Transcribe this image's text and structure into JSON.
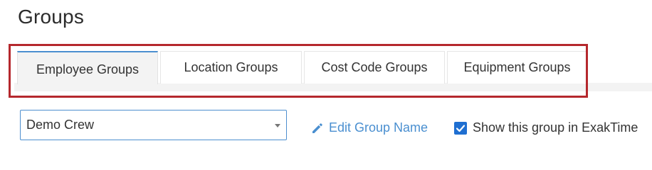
{
  "page": {
    "title": "Groups"
  },
  "tabs": [
    {
      "label": "Employee Groups",
      "active": true
    },
    {
      "label": "Location Groups",
      "active": false
    },
    {
      "label": "Cost Code Groups",
      "active": false
    },
    {
      "label": "Equipment Groups",
      "active": false
    }
  ],
  "group_select": {
    "value": "Demo Crew",
    "icon": "caret-down-icon"
  },
  "edit_link": {
    "label": "Edit Group Name",
    "icon": "pencil-icon"
  },
  "show_checkbox": {
    "label": "Show this group in ExakTime",
    "checked": true
  },
  "colors": {
    "accent_blue": "#4a8fd0",
    "highlight_red": "#b5282d",
    "checkbox_blue": "#1f6fd1"
  }
}
